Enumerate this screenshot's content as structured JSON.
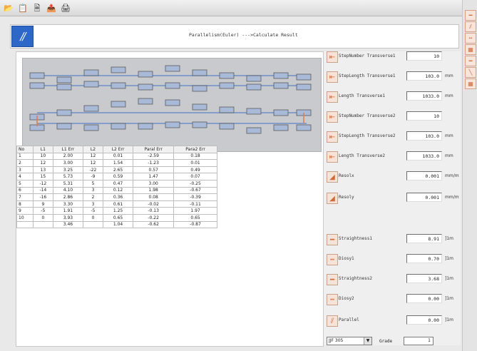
{
  "banner": {
    "logo": "//",
    "title": "Parallelism(Euler) --->Calculate Result"
  },
  "toolbar": {
    "icons": [
      "open-icon",
      "copy-icon",
      "scan-icon",
      "export-icon",
      "print-icon"
    ]
  },
  "colors": {
    "accent": "#e07b4a",
    "banner_logo": "#2d68c8",
    "connector": "#6f8fc8"
  },
  "table": {
    "headers": [
      "No",
      "L1",
      "L1 Err",
      "L2",
      "L2 Err",
      "Paral Err",
      "Para2 Err"
    ],
    "rows": [
      [
        "1",
        "10",
        "2.00",
        "12",
        "0.01",
        "-2.59",
        "0.18"
      ],
      [
        "2",
        "12",
        "3.00",
        "12",
        "1.54",
        "-1.23",
        "0.01"
      ],
      [
        "3",
        "13",
        "3.25",
        "-22",
        "2.65",
        "0.57",
        "0.49"
      ],
      [
        "4",
        "15",
        "5.73",
        "-9",
        "0.59",
        "1.47",
        "0.07"
      ],
      [
        "5",
        "-12",
        "5.31",
        "5",
        "0.47",
        "3.00",
        "-0.25"
      ],
      [
        "6",
        "-14",
        "4.10",
        "3",
        "0.12",
        "1.98",
        "-0.67"
      ],
      [
        "7",
        "-16",
        "2.86",
        "2",
        "0.36",
        "0.08",
        "-0.39"
      ],
      [
        "8",
        "9",
        "3.30",
        "3",
        "0.61",
        "-0.02",
        "-0.11"
      ],
      [
        "9",
        "-5",
        "1.91",
        "-5",
        "1.25",
        "-0.13",
        "1.97"
      ],
      [
        "10",
        "0",
        "3.93",
        "0",
        "0.65",
        "-0.22",
        "0.65"
      ],
      [
        "",
        "",
        "3.46",
        "",
        "1.04",
        "-0.62",
        "-0.87"
      ]
    ]
  },
  "params": [
    {
      "label": "StepNumber Transverse1",
      "value": "10",
      "unit": ""
    },
    {
      "label": "StepLength Transverse1",
      "value": "103.0",
      "unit": "mm"
    },
    {
      "label": "Length Transverse1",
      "value": "1033.0",
      "unit": "mm"
    },
    {
      "label": "StepNumber Transverse2",
      "value": "10",
      "unit": ""
    },
    {
      "label": "StepLength Transverse2",
      "value": "103.0",
      "unit": "mm"
    },
    {
      "label": "Length Transverse2",
      "value": "1033.0",
      "unit": "mm"
    },
    {
      "label": "Resolx",
      "value": "0.001",
      "unit": "mm/m"
    },
    {
      "label": "Resoly",
      "value": "0.001",
      "unit": "mm/m"
    }
  ],
  "results": [
    {
      "label": "Straightness1",
      "value": "8.91",
      "unit": "]1m"
    },
    {
      "label": "Diosy1",
      "value": "0.70",
      "unit": "]1m"
    },
    {
      "label": "Straightness2",
      "value": "3.68",
      "unit": "]1m"
    },
    {
      "label": "Diosy2",
      "value": "0.00",
      "unit": "]1m"
    },
    {
      "label": "Parallel",
      "value": "0.00",
      "unit": "]1m"
    }
  ],
  "footer": {
    "select_value": "JJF 305",
    "grade_label": "Grade",
    "grade_value": "1"
  }
}
